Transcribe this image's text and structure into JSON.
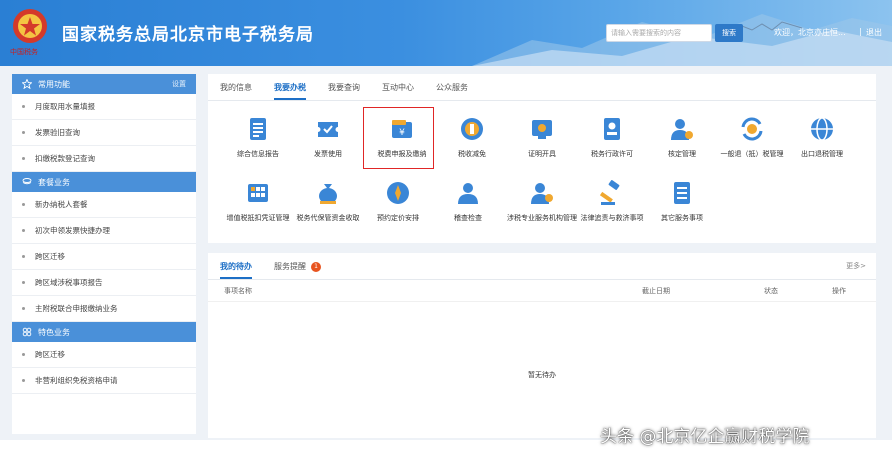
{
  "header": {
    "title": "国家税务总局北京市电子税务局",
    "emblem_caption": "中国税务",
    "search_placeholder": "请输入需要搜索的内容",
    "search_button": "搜索",
    "welcome": "欢迎，北京亦庄恒...",
    "separator": "|",
    "logout": "退出",
    "brand_color": "#2a7fd4"
  },
  "sidebar": {
    "sections": [
      {
        "title": "常用功能",
        "icon": "star-icon",
        "action": "设置",
        "items": [
          "月度取用水量填报",
          "发票验旧查询",
          "扣缴税款登记查询"
        ]
      },
      {
        "title": "套餐业务",
        "icon": "layers-icon",
        "items": [
          "新办纳税人套餐",
          "初次申领发票快捷办理",
          "跨区迁移",
          "跨区域涉税事项报告",
          "主附税联合申报缴纳业务"
        ]
      },
      {
        "title": "特色业务",
        "icon": "grid-icon",
        "items": [
          "跨区迁移",
          "非营利组织免税资格申请"
        ]
      }
    ]
  },
  "tabs": [
    "我的信息",
    "我要办税",
    "我要查询",
    "互动中心",
    "公众服务"
  ],
  "active_tab_index": 1,
  "services": [
    {
      "label": "综合信息报告",
      "icon": "document-icon"
    },
    {
      "label": "发票使用",
      "icon": "ticket-icon"
    },
    {
      "label": "税费申报及缴纳",
      "icon": "tax-payment-icon"
    },
    {
      "label": "税收减免",
      "icon": "coin-icon"
    },
    {
      "label": "证明开具",
      "icon": "certificate-icon"
    },
    {
      "label": "税务行政许可",
      "icon": "permit-icon"
    },
    {
      "label": "核定管理",
      "icon": "user-gear-icon"
    },
    {
      "label": "一般退（抵）税管理",
      "icon": "refund-icon"
    },
    {
      "label": "出口退税管理",
      "icon": "globe-icon"
    },
    {
      "label": "增值税抵扣凭证管理",
      "icon": "calculator-icon"
    },
    {
      "label": "税务代保管资金收取",
      "icon": "money-bag-icon"
    },
    {
      "label": "预约定价安排",
      "icon": "compass-icon"
    },
    {
      "label": "稽查检查",
      "icon": "inspector-icon"
    },
    {
      "label": "涉税专业服务机构管理",
      "icon": "agency-icon"
    },
    {
      "label": "法律追责与救济事项",
      "icon": "gavel-icon"
    },
    {
      "label": "其它服务事项",
      "icon": "list-icon"
    }
  ],
  "highlighted_service_index": 2,
  "highlight_color": "#e02626",
  "todo": {
    "tabs": [
      "我的待办",
      "服务提醒"
    ],
    "reminder_badge": "1",
    "more": "更多>",
    "columns": [
      "事项名称",
      "截止日期",
      "状态",
      "操作"
    ],
    "empty_text": "暂无待办"
  },
  "watermark": "头条 @北京亿企赢财税学院"
}
